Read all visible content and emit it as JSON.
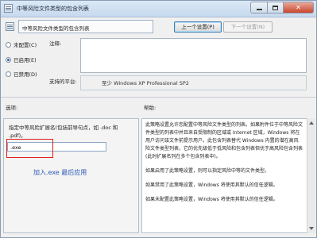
{
  "window": {
    "title": "中等风险文件类型的包含列表"
  },
  "header": {
    "policy_name": "中等风险文件类型的包含列表",
    "prev_button": "上一个设置(P)",
    "next_button": "下一个设置(N)"
  },
  "state": {
    "options": [
      {
        "label": "未配置(C)",
        "checked": false
      },
      {
        "label": "已启用(E)",
        "checked": true
      },
      {
        "label": "已禁用(D)",
        "checked": false
      }
    ]
  },
  "comment": {
    "label": "注释:",
    "value": ""
  },
  "platform": {
    "label": "支持的平台:",
    "value": "至少 Windows XP Professional SP2"
  },
  "options_section": {
    "label": "选项:",
    "description": "指定中等风险扩展名(包括前导句点，如 .doc 和 .pdf)。",
    "extension_value": ".exe",
    "annotation": "加入.exe 最后应用"
  },
  "help_section": {
    "label": "帮助:",
    "paragraphs": [
      "此策略设置允许您配置中等风险文件类型的列表。如果附件位于中等风险文件类型的列表中并且来自受限制的区域或 Internet 区域，Windows 将在用户访问该文件前提示用户。此包含列表替代 Windows 内置的潜在高风险文件类型列表，它的优先级低于低风险和包含列表但优于高风险包含列表(此时扩展名列在多个包含列表中)。",
      "如果启用了此策略设置，则可以指定风险中等的文件类型。",
      "如果禁用了此策略设置，Windows 将使用其默认的信任逻辑。",
      "如果未配置此策略设置，Windows 将使用其默认的信任逻辑。"
    ]
  },
  "colors": {
    "annotation_text": "#2a57b6",
    "highlight_border": "#e41d1d"
  }
}
